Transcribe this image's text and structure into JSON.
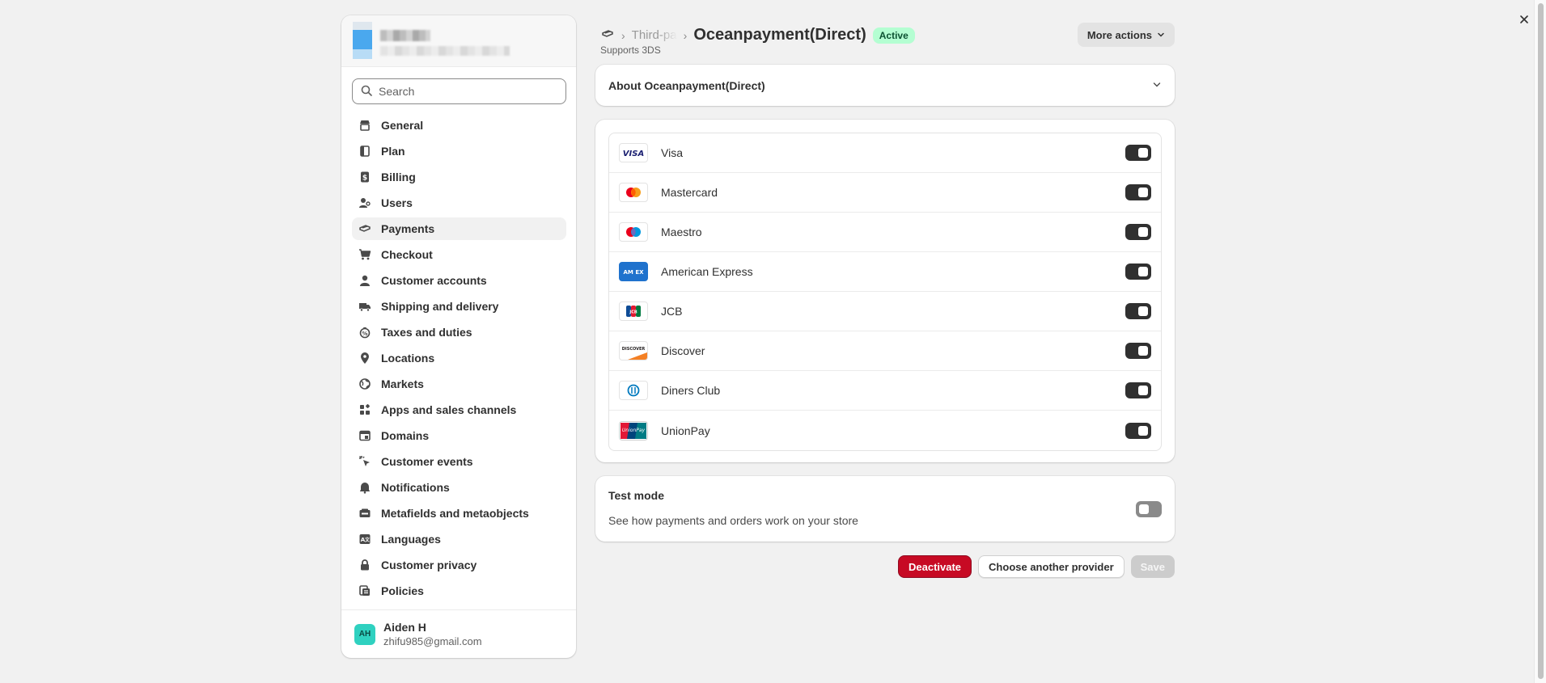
{
  "sidebar": {
    "search": {
      "placeholder": "Search"
    },
    "items": [
      {
        "label": "General",
        "icon": "store-icon"
      },
      {
        "label": "Plan",
        "icon": "plan-icon"
      },
      {
        "label": "Billing",
        "icon": "billing-icon"
      },
      {
        "label": "Users",
        "icon": "users-icon"
      },
      {
        "label": "Payments",
        "icon": "payments-icon",
        "active": true
      },
      {
        "label": "Checkout",
        "icon": "cart-icon"
      },
      {
        "label": "Customer accounts",
        "icon": "person-icon"
      },
      {
        "label": "Shipping and delivery",
        "icon": "truck-icon"
      },
      {
        "label": "Taxes and duties",
        "icon": "tax-icon"
      },
      {
        "label": "Locations",
        "icon": "location-icon"
      },
      {
        "label": "Markets",
        "icon": "globe-icon"
      },
      {
        "label": "Apps and sales channels",
        "icon": "apps-icon"
      },
      {
        "label": "Domains",
        "icon": "domain-icon"
      },
      {
        "label": "Customer events",
        "icon": "cursor-icon"
      },
      {
        "label": "Notifications",
        "icon": "bell-icon"
      },
      {
        "label": "Metafields and metaobjects",
        "icon": "metafields-icon"
      },
      {
        "label": "Languages",
        "icon": "language-icon"
      },
      {
        "label": "Customer privacy",
        "icon": "lock-icon"
      },
      {
        "label": "Policies",
        "icon": "policies-icon"
      }
    ],
    "user": {
      "initials": "AH",
      "name": "Aiden H",
      "email": "zhifu985@gmail.com"
    }
  },
  "header": {
    "breadcrumb_parent": "Third-party",
    "title": "Oceanpayment(Direct)",
    "status": "Active",
    "subtitle": "Supports 3DS",
    "more_actions": "More actions"
  },
  "about": {
    "title": "About Oceanpayment(Direct)"
  },
  "methods": [
    {
      "name": "Visa",
      "logo": "visa-logo",
      "enabled": true
    },
    {
      "name": "Mastercard",
      "logo": "mastercard-logo",
      "enabled": true
    },
    {
      "name": "Maestro",
      "logo": "maestro-logo",
      "enabled": true
    },
    {
      "name": "American Express",
      "logo": "amex-logo",
      "enabled": true
    },
    {
      "name": "JCB",
      "logo": "jcb-logo",
      "enabled": true
    },
    {
      "name": "Discover",
      "logo": "discover-logo",
      "enabled": true
    },
    {
      "name": "Diners Club",
      "logo": "diners-logo",
      "enabled": true
    },
    {
      "name": "UnionPay",
      "logo": "unionpay-logo",
      "enabled": true
    }
  ],
  "logo_text": {
    "visa": "VISA",
    "amex": "AM EX",
    "jcb": "JCB",
    "discover": "DISCOVER",
    "unionpay": "UnionPay"
  },
  "test_mode": {
    "title": "Test mode",
    "description": "See how payments and orders work on your store",
    "enabled": false
  },
  "actions": {
    "deactivate": "Deactivate",
    "choose_provider": "Choose another provider",
    "save": "Save"
  },
  "colors": {
    "accent_dark": "#303030",
    "badge_bg": "#b4fed2",
    "danger": "#c70a24"
  }
}
